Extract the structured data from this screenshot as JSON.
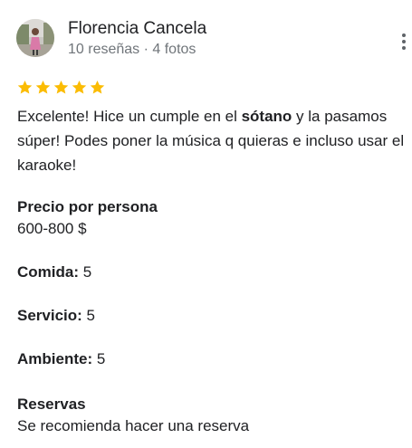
{
  "author": {
    "name": "Florencia Cancela",
    "meta": "10 reseñas · 4 fotos"
  },
  "rating": {
    "stars": 5,
    "max": 5,
    "star_color": "#fbbc04"
  },
  "review": {
    "text_before": "Excelente! Hice un cumple en el ",
    "text_bold": "sótano",
    "text_after": " y la pasamos súper! Podes poner la música q quieras e incluso usar el karaoke!"
  },
  "attributes": {
    "price": {
      "title": "Precio por persona",
      "value": "600-800 $"
    },
    "food": {
      "title": "Comida:",
      "value": "5"
    },
    "service": {
      "title": "Servicio:",
      "value": "5"
    },
    "atmosphere": {
      "title": "Ambiente:",
      "value": "5"
    },
    "reservations": {
      "title": "Reservas",
      "value": "Se recomienda hacer una reserva"
    }
  },
  "icons": {
    "more": "more-vert-icon",
    "star": "star-icon"
  }
}
